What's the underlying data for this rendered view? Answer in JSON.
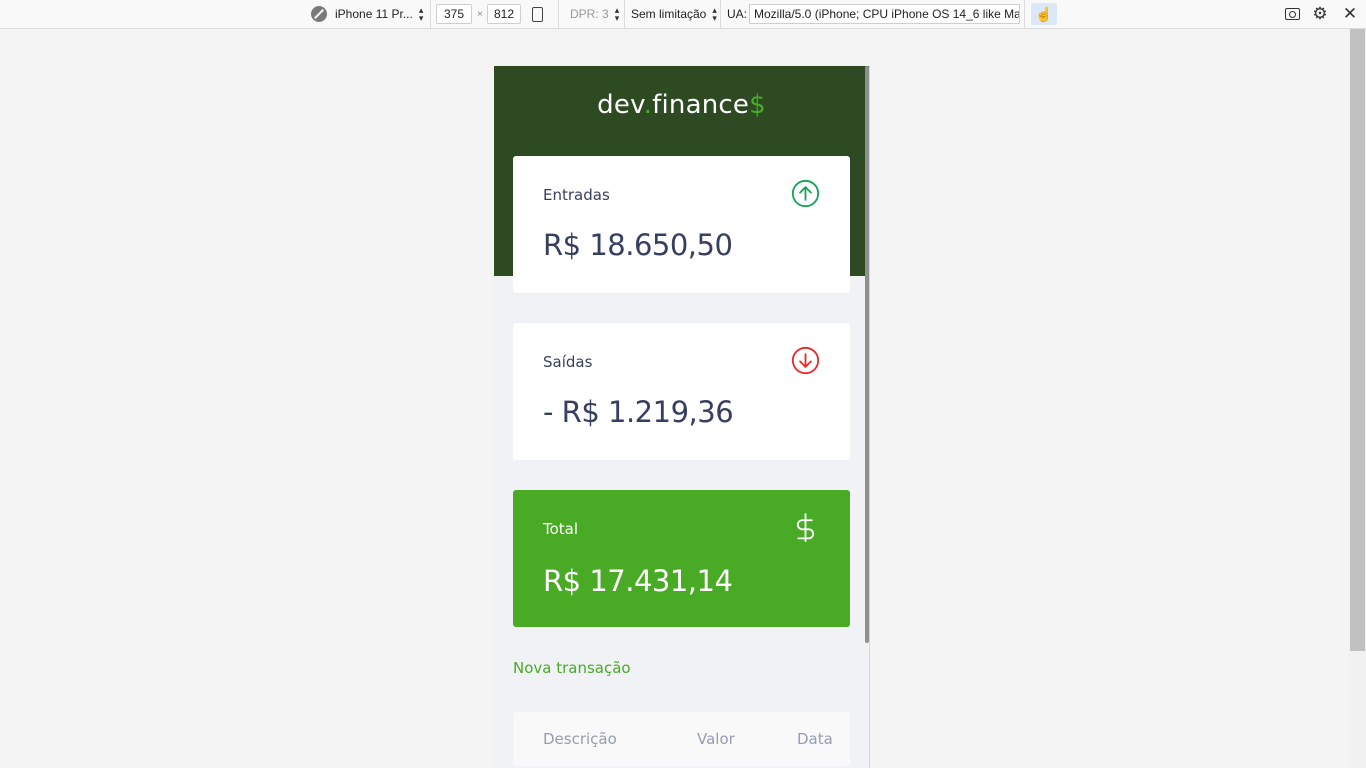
{
  "toolbar": {
    "device_name": "iPhone 11 Pr...",
    "width_value": "375",
    "times_sign": "×",
    "height_value": "812",
    "dpr": "DPR: 3",
    "throttling": "Sem limitação",
    "ua_label": "UA:",
    "user_agent": "Mozilla/5.0 (iPhone; CPU iPhone OS 14_6 like Mac",
    "icons": [
      "device-icon",
      "rotate-icon",
      "touch-simulation-icon",
      "camera-icon",
      "gear-icon",
      "close-icon"
    ]
  },
  "app": {
    "logo_main": "dev",
    "logo_dot": ".",
    "logo_rest": "finance",
    "logo_dollar": "$",
    "cards": {
      "entradas": {
        "title": "Entradas",
        "value": "R$ 18.650,50",
        "icon": "arrow-up-circle-icon",
        "icon_color": "#12a454"
      },
      "saidas": {
        "title": "Saídas",
        "value": "- R$ 1.219,36",
        "icon": "arrow-down-circle-icon",
        "icon_color": "#e92929"
      },
      "total": {
        "title": "Total",
        "value": "R$ 17.431,14",
        "icon": "dollar-sign-icon",
        "background": "#49aa26"
      }
    },
    "nova_transacao": "Nova transação",
    "table": {
      "headers": [
        "Descrição",
        "Valor",
        "Data"
      ]
    },
    "colors": {
      "header": "#2d4a22",
      "accent": "#49aa26",
      "text": "#363f5f",
      "page_background": "#f0f2f5"
    }
  }
}
